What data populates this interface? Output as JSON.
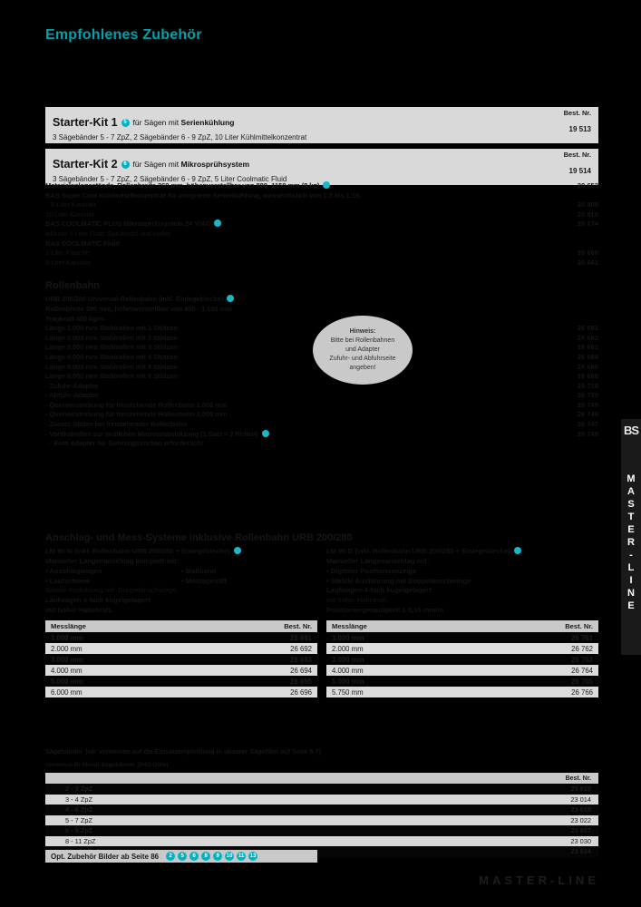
{
  "page": {
    "title": "Empfohlenes Zubehör",
    "accent": "#00a0ad",
    "bg": "#000000"
  },
  "kits": [
    {
      "bestnr_label": "Best. Nr.",
      "name": "Starter-Kit 1",
      "badge": "5",
      "for_prefix": "für Sägen mit ",
      "for_bold": "Serienkühlung",
      "desc": "3 Sägebänder 5 - 7 ZpZ, 2 Sägebänder 6 - 9 ZpZ, 10 Liter Kühlmittelkonzentrat",
      "number": "19 513"
    },
    {
      "bestnr_label": "Best. Nr.",
      "name": "Starter-Kit 2",
      "badge": "6",
      "for_prefix": "für Sägen mit ",
      "for_bold": "Mikrosprühsystem",
      "desc": "3 Sägebänder 5 - 7 ZpZ, 2 Sägebänder 6 - 9 ZpZ, 5 Liter Coolmatic Fluid",
      "number": "19 514"
    }
  ],
  "dark_list": [
    {
      "text": "Materialanlagestände, Rollenbreite 260 mm, höhenverstellbar von 880 -1150 mm (8 kg)",
      "bold": true,
      "dot": true,
      "number": "20 653"
    },
    {
      "text": "BAS Super Cool Kühlmittelkonzentrat für integrierte Serienkühlung, wassertöslich von 1:5 bis 1:15",
      "bold": true,
      "number": ""
    },
    {
      "text": "5-Liter Kanister",
      "indent": true,
      "number": "20 805"
    },
    {
      "text": "10-Liter Kanister",
      "number": "20 810"
    },
    {
      "text": "BAS COOLMATIC PLUS Mikrosprühsystem 24 V/AC",
      "bold": true,
      "dot": true,
      "number": "20 674"
    },
    {
      "text": "inklusiv 1 Liter Fluid, Sprühkopf und Halter",
      "number": ""
    },
    {
      "text": "BAS COOLMATIC Fluid",
      "bold": true,
      "number": ""
    },
    {
      "text": "1-Liter Flasche",
      "number": "20 660"
    },
    {
      "text": "5-Liter Kanister",
      "number": "20 661"
    }
  ],
  "rollenbahn": {
    "heading": "Rollenbahn",
    "rows": [
      {
        "text": "URB 200/280 Universal-Rollenbahn (inkl. Einlegebleche)",
        "bold": true,
        "dot": true,
        "number": ""
      },
      {
        "text": "Rollenbreite 280 mm, höhenverstellbar von 850 - 1.150 mm",
        "bold": true,
        "number": ""
      },
      {
        "text": "Tragkraft 400 kg/m",
        "bold": true,
        "number": ""
      },
      {
        "text": "Länge 1.000 mm Stahlrollen mit 1 Stützen",
        "bold": true,
        "number": "26 681"
      },
      {
        "text": "Länge 2.000 mm Stahlrollen mit 2 Stützen",
        "bold": true,
        "number": "26 682"
      },
      {
        "text": "Länge 3.000 mm Stahlrollen mit 3 Stützen",
        "bold": true,
        "number": "26 683"
      },
      {
        "text": "Länge 4.000 mm Stahlrollen mit 4 Stützen",
        "bold": true,
        "number": "26 684"
      },
      {
        "text": "Länge 5.000 mm Stahlrollen mit 5 Stützen",
        "bold": true,
        "number": "26 685"
      },
      {
        "text": "Länge 6.000 mm Stahlrollen mit 6 Stützen",
        "bold": true,
        "number": "26 686"
      },
      {
        "text": "- Zufuhr-Adapter",
        "bold": true,
        "number": "26 718"
      },
      {
        "text": "- Abfuhr-Adapter",
        "bold": true,
        "number": "26 719"
      },
      {
        "text": "- Querverstrebung für freistehende Rollenbahn 1.000 mm",
        "bold": true,
        "number": "26 745"
      },
      {
        "text": "- Querverstrebung für freistehende Rollenbahn 2.000 mm",
        "bold": true,
        "number": "26 746"
      },
      {
        "text": "- Zusatz-Stütze bei freistehender Rollenbahn",
        "bold": true,
        "number": "26 747"
      },
      {
        "text": "- Vertikalrollen zur seitlichen Materialabstützung (1 Satz = 2 Rollen)",
        "bold": true,
        "dot": true,
        "number": "26 748"
      },
      {
        "text": "→ Kein Adapter für Gehrungsvorbau erforderlich!",
        "bold": true,
        "number": ""
      }
    ]
  },
  "hinweis": {
    "title": "Hinweis:",
    "line1": "Bitte bei Rollenbahnen",
    "line2": "und Adapter",
    "line3": "Zufuhr- und Abfuhrseite",
    "line4": "angeben!"
  },
  "anschlag": {
    "title": "Anschlag- und Mess-Systeme inklusive Rollenbahn URB 200/280",
    "left": {
      "heading": "LM 90 M (inkl. Rollenbahn URB 200/280 + Einlegebleche)",
      "dot": true,
      "sub": "Manueller Längenanschlag komplett mit:",
      "bullets_col1": [
        "• Anschlagwagen",
        "• Laufschiene"
      ],
      "bullets_col2": [
        "• Maßband",
        "• Montagestift"
      ],
      "lines": [
        "Stabile Ausführung mit: Doppelanschwinge.",
        "Laufwagen 4-fach kugelgelagert",
        "mit hoher Haltekraft."
      ]
    },
    "right": {
      "heading": "LM 90 D (inkl. Rollenbahn URB 200/280 + Einlegebleche)",
      "dot": true,
      "sub": "Manueller Längenanschlag mit:",
      "bullets_col1": [
        "• Digitaler Positionsanzeige",
        "• Stabile Ausführung mit Doppelanschwinge"
      ],
      "bullets_col2": [],
      "lines": [
        "Laufwagen 4-fach kugelgelagert",
        "mit hoher Haltekraft.",
        "Positioniergenauigkeit ± 0,10 mm/m"
      ]
    }
  },
  "mess_tables": [
    {
      "name": "lm90m",
      "headers": [
        "Messlänge",
        "Best. Nr."
      ],
      "rows": [
        [
          "1.000 mm",
          "26 691"
        ],
        [
          "2.000 mm",
          "26 692"
        ],
        [
          "3.000 mm",
          "26 693"
        ],
        [
          "4.000 mm",
          "26 694"
        ],
        [
          "5.000 mm",
          "26 695"
        ],
        [
          "6.000 mm",
          "26 696"
        ]
      ]
    },
    {
      "name": "lm90d",
      "headers": [
        "Messlänge",
        "Best. Nr."
      ],
      "rows": [
        [
          "1.000 mm",
          "26 761"
        ],
        [
          "2.000 mm",
          "26 762"
        ],
        [
          "3.000 mm",
          "26 763"
        ],
        [
          "4.000 mm",
          "26 764"
        ],
        [
          "5.000 mm",
          "26 765"
        ],
        [
          "5.750 mm",
          "26 766"
        ]
      ]
    }
  ],
  "saegebaender": {
    "title": "Sägebänder",
    "title_note": "(wir verweisen auf die Einsatzempfehlung in unserer Sägefibel auf Seite 6-7)",
    "subtitle": "Universal-Bi-Metall-Sägebänder (M42-Güte)",
    "header_right": "Best. Nr.",
    "rows": [
      [
        "2 - 3 ZpZ",
        "23 010"
      ],
      [
        "3 - 4 ZpZ",
        "23 014"
      ],
      [
        "4 - 6 ZpZ",
        "23 018"
      ],
      [
        "5 - 7 ZpZ",
        "23 022"
      ],
      [
        "6 - 9 ZpZ",
        "23 027"
      ],
      [
        "8 - 11 ZpZ",
        "23 030"
      ],
      [
        "10 - 14 ZpZ",
        "23 034"
      ]
    ]
  },
  "footer_bar": {
    "label": "Opt. Zubehör Bilder ab Seite 86",
    "badges": [
      "2",
      "5",
      "6",
      "8",
      "9",
      "10",
      "11",
      "13"
    ]
  },
  "side_tab": {
    "logo": "BS",
    "text": "MASTER-LINE"
  },
  "footer_brand": "MASTER-LINE"
}
